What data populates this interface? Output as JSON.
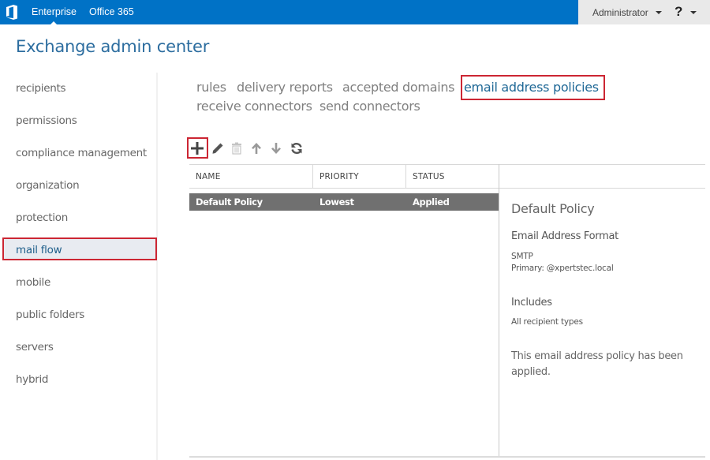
{
  "topbar": {
    "logo_icon": "office-logo-icon",
    "links": [
      {
        "label": "Enterprise",
        "active": true
      },
      {
        "label": "Office 365",
        "active": false
      }
    ],
    "user": "Administrator",
    "help": "?"
  },
  "app": {
    "title": "Exchange admin center"
  },
  "sidebar": {
    "items": [
      {
        "label": "recipients",
        "active": false
      },
      {
        "label": "permissions",
        "active": false
      },
      {
        "label": "compliance management",
        "active": false
      },
      {
        "label": "organization",
        "active": false
      },
      {
        "label": "protection",
        "active": false
      },
      {
        "label": "mail flow",
        "active": true
      },
      {
        "label": "mobile",
        "active": false
      },
      {
        "label": "public folders",
        "active": false
      },
      {
        "label": "servers",
        "active": false
      },
      {
        "label": "hybrid",
        "active": false
      }
    ]
  },
  "subnav": {
    "items": [
      {
        "label": "rules",
        "active": false
      },
      {
        "label": "delivery reports",
        "active": false
      },
      {
        "label": "accepted domains",
        "active": false
      },
      {
        "label": "email address policies",
        "active": true
      },
      {
        "label": "receive connectors",
        "active": false
      },
      {
        "label": "send connectors",
        "active": false
      }
    ]
  },
  "toolbar": {
    "buttons": [
      {
        "icon": "add-icon",
        "label": "New"
      },
      {
        "icon": "edit-icon",
        "label": "Edit"
      },
      {
        "icon": "delete-icon",
        "label": "Delete"
      },
      {
        "icon": "move-up-icon",
        "label": "Move up"
      },
      {
        "icon": "move-down-icon",
        "label": "Move down"
      },
      {
        "icon": "refresh-icon",
        "label": "Refresh"
      }
    ]
  },
  "table": {
    "columns": [
      "NAME",
      "PRIORITY",
      "STATUS"
    ],
    "rows": [
      {
        "name": "Default Policy",
        "priority": "Lowest",
        "status": "Applied",
        "selected": true
      }
    ]
  },
  "details": {
    "title": "Default Policy",
    "format_heading": "Email Address Format",
    "format_type": "SMTP",
    "format_primary": "Primary: @xpertstec.local",
    "includes_heading": "Includes",
    "includes_value": "All recipient types",
    "status_message": "This email address policy has been applied."
  },
  "colors": {
    "topbar": "#0072c6",
    "accent_text": "#2c6d9f",
    "selected_row": "#707070",
    "highlight_box": "#cc2633"
  }
}
